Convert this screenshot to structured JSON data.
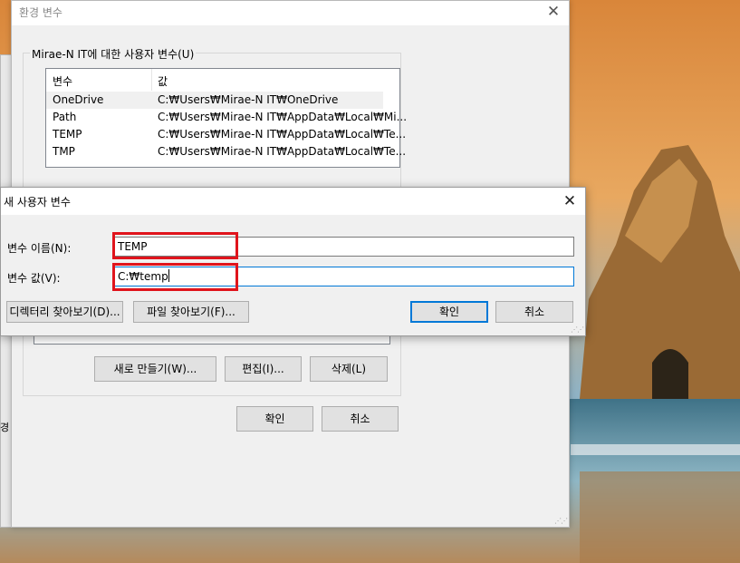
{
  "env_window": {
    "title": "환경 변수",
    "user_group_label": "Mirae-N IT에 대한 사용자 변수(U)",
    "table": {
      "headers": [
        "변수",
        "값"
      ],
      "rows": [
        {
          "name": "OneDrive",
          "value": "C:₩Users₩Mirae-N IT₩OneDrive"
        },
        {
          "name": "Path",
          "value": "C:₩Users₩Mirae-N IT₩AppData₩Local₩Mi..."
        },
        {
          "name": "TEMP",
          "value": "C:₩Users₩Mirae-N IT₩AppData₩Local₩Te..."
        },
        {
          "name": "TMP",
          "value": "C:₩Users₩Mirae-N IT₩AppData₩Local₩Te..."
        }
      ]
    },
    "buttons": {
      "new": "새로 만들기(W)...",
      "edit": "편집(I)...",
      "delete": "삭제(L)",
      "ok": "확인",
      "cancel": "취소"
    },
    "left_strip_text": "경"
  },
  "new_dialog": {
    "title": "새 사용자 변수",
    "name_label": "변수 이름(N):",
    "name_value": "TEMP",
    "value_label": "변수 값(V):",
    "value_value": "C:₩temp",
    "browse_dir": "디렉터리 찾아보기(D)...",
    "browse_file": "파일 찾아보기(F)...",
    "ok": "확인",
    "cancel": "취소"
  },
  "colors": {
    "accent": "#0078d7",
    "highlight": "#e0141c"
  }
}
